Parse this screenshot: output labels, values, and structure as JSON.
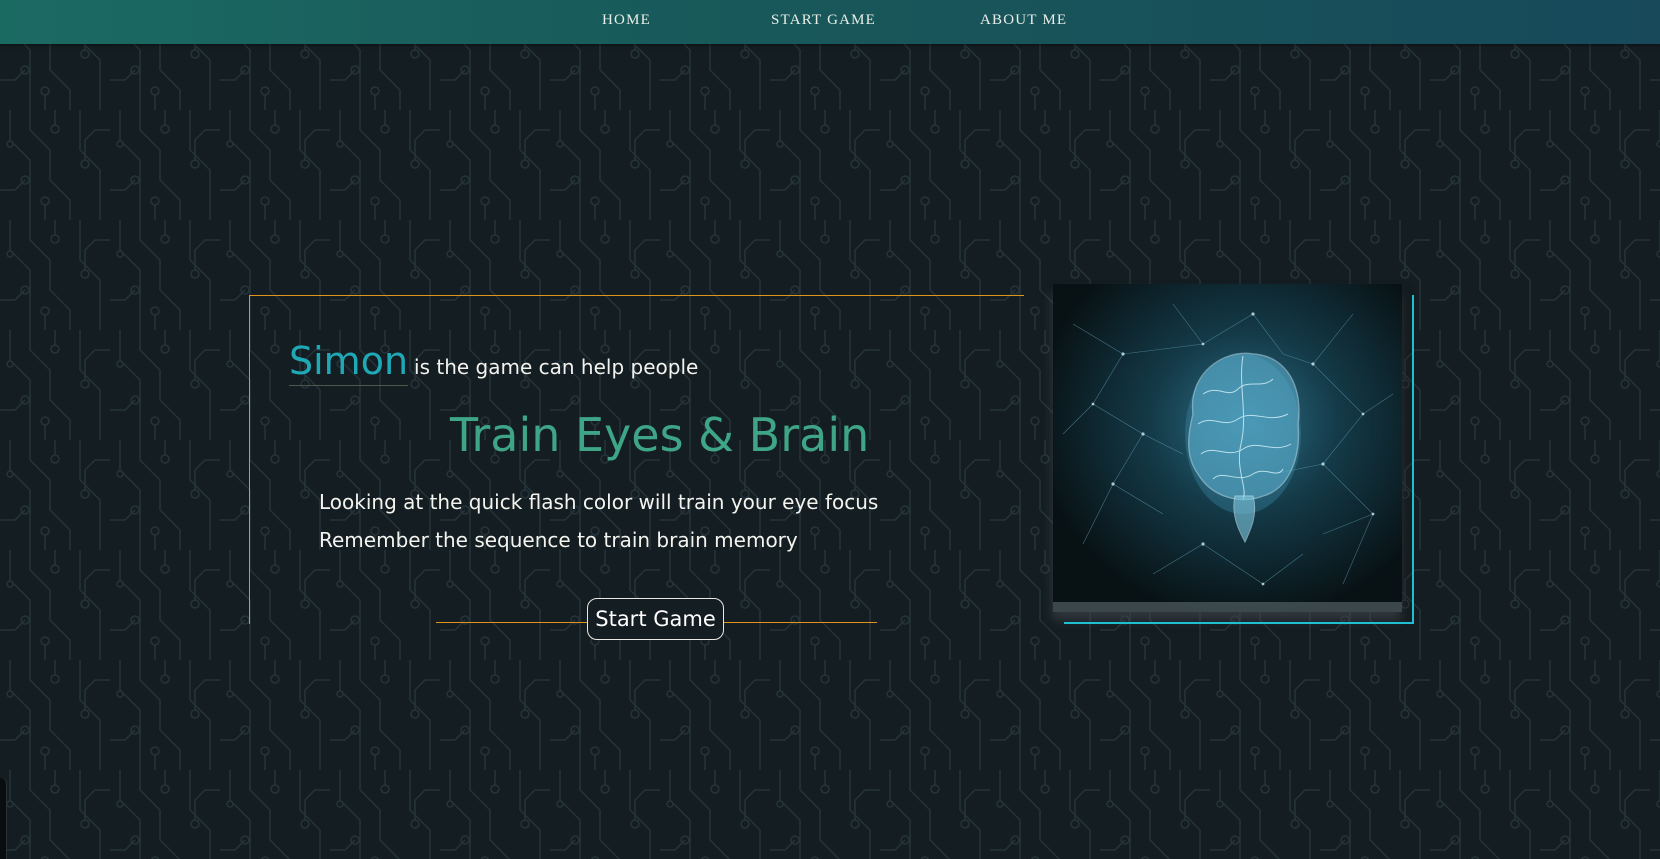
{
  "nav": {
    "home": "HOME",
    "start_game": "START GAME",
    "about_me": "ABOUT ME"
  },
  "hero": {
    "simon": "Simon",
    "intro": "is the game can help people",
    "headline": "Train Eyes & Brain",
    "desc_1": "Looking at the quick flash color will train your eye focus",
    "desc_2": "Remember the sequence to train brain memory",
    "button": "Start Game"
  },
  "colors": {
    "nav_gradient_start": "#1b6a62",
    "nav_gradient_end": "#17495a",
    "background": "#141d22",
    "accent_teal": "#1fa9b6",
    "accent_green": "#3ea586",
    "frame_orange": "#e0951a",
    "frame_cyan": "#1ebfd0"
  },
  "image": {
    "icon": "brain-hologram-image"
  }
}
